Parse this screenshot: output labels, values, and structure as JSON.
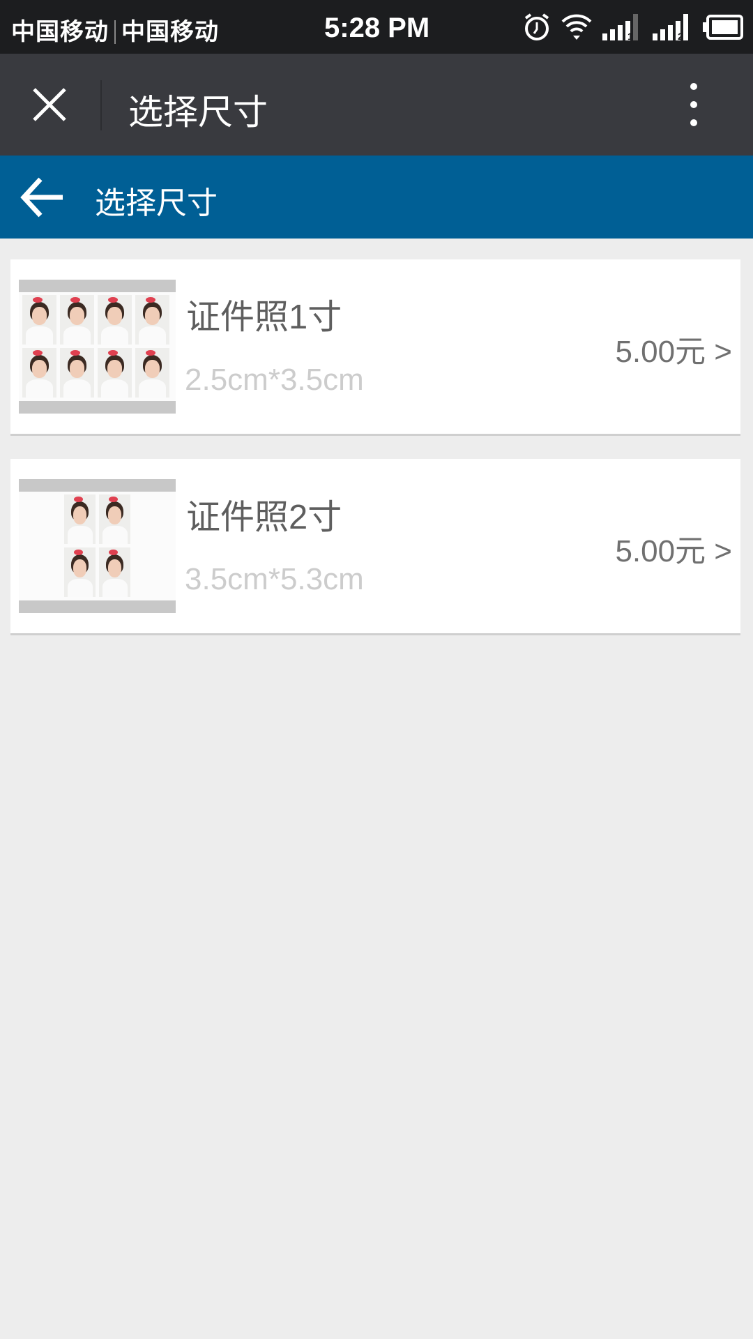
{
  "status_bar": {
    "carrier1": "中国移动",
    "carrier2": "中国移动",
    "time": "5:28 PM",
    "icons": [
      "alarm-icon",
      "wifi-icon",
      "signal-sim1-icon",
      "signal-sim2-icon",
      "battery-icon"
    ],
    "sim1": "1",
    "sim2": "2"
  },
  "title_bar": {
    "title": "选择尺寸",
    "close_icon": "close-icon",
    "menu_icon": "more-vertical-icon",
    "bg": "#393a3f"
  },
  "header": {
    "title": "选择尺寸",
    "back_icon": "arrow-left-icon",
    "bg": "#005f95"
  },
  "items": [
    {
      "name": "证件照1寸",
      "size": "2.5cm*3.5cm",
      "price": "5.00元 >"
    },
    {
      "name": "证件照2寸",
      "size": "3.5cm*5.3cm",
      "price": "5.00元 >"
    }
  ]
}
